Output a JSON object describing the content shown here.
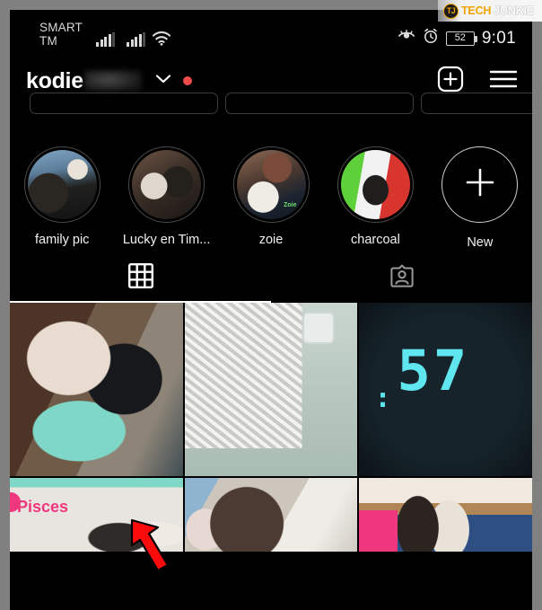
{
  "watermark": {
    "logo_text": "TJ",
    "brand_part1": "TECH",
    "brand_part2": "JUNKIE"
  },
  "status_bar": {
    "carrier_line1": "SMART",
    "carrier_line2": "TM",
    "signal_1_icon": "signal-bars-icon",
    "signal_2_icon": "signal-bars-icon",
    "wifi_icon": "wifi-icon",
    "eye_icon": "eye-icon",
    "alarm_icon": "alarm-clock-icon",
    "battery_level": "52",
    "time": "9:01"
  },
  "profile_header": {
    "username": "kodie",
    "username_blurred_suffix": "",
    "chevron_icon": "chevron-down-icon",
    "notification_dot": "red-dot-indicator",
    "add_icon": "plus-square-icon",
    "menu_icon": "hamburger-menu-icon"
  },
  "action_buttons": [
    {
      "label": ""
    },
    {
      "label": ""
    },
    {
      "label": ""
    }
  ],
  "highlights": [
    {
      "label": "family pic",
      "art": "art-family"
    },
    {
      "label": "Lucky en Tim...",
      "art": "art-lucky"
    },
    {
      "label": "zoie",
      "art": "art-zoie",
      "overlay_text": "Zoie"
    },
    {
      "label": "charcoal",
      "art": "art-charcoal"
    },
    {
      "label": "New",
      "art": "plus-icon"
    }
  ],
  "tabs": [
    {
      "name": "grid",
      "icon": "grid-icon",
      "active": true
    },
    {
      "name": "tagged",
      "icon": "tagged-person-icon",
      "active": false
    }
  ],
  "grid_posts": [
    {
      "art": "ph1",
      "alt_text": "two dogs on teal chair"
    },
    {
      "art": "ph2",
      "alt_text": "striped mat on floor"
    },
    {
      "art": "ph3",
      "alt_text": "LED pixel clock",
      "led_text": "57"
    },
    {
      "art": "ph4",
      "alt_text": "dog photo with Pisces sticker",
      "overlay_text": "Pisces"
    },
    {
      "art": "ph5",
      "alt_text": "brown dog close up"
    },
    {
      "art": "ph6",
      "alt_text": "two puppies on bed"
    }
  ],
  "annotation": {
    "arrow_icon": "red-arrow-pointer",
    "arrow_color": "#fb0b0b",
    "arrow_outline": "#000000"
  },
  "colors": {
    "frame": "#808080",
    "screen_bg": "#000000",
    "accent_red": "#ef4a4a",
    "text_primary": "#ffffff",
    "text_muted": "#d8d8d8",
    "brand_orange": "#f0a400",
    "pisces_pink": "#f0377e",
    "led_cyan": "#5fe6ee"
  }
}
